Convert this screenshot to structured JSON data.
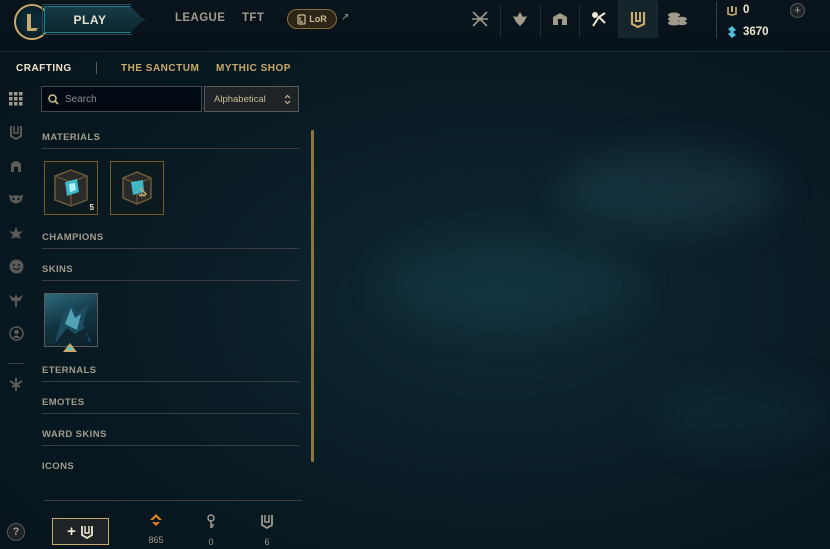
{
  "topbar": {
    "play_label": "PLAY",
    "nav": [
      {
        "label": "LEAGUE",
        "icon": "league-nav"
      },
      {
        "label": "TFT",
        "icon": "tft-nav"
      }
    ],
    "lor_label": "LoR",
    "icons": [
      "rewards-icon",
      "ranked-icon",
      "store-icon",
      "collection-icon",
      "loot-icon",
      "store-currency-icon"
    ],
    "orange_essence": "0",
    "blue_essence": "3670"
  },
  "subnav": {
    "crafting": "CRAFTING",
    "sanctum": "THE SANCTUM",
    "mythic_shop": "MYTHIC SHOP"
  },
  "filters": {
    "search_placeholder": "Search",
    "sort_value": "Alphabetical"
  },
  "sections": {
    "materials": "MATERIALS",
    "champions": "CHAMPIONS",
    "skins": "SKINS",
    "eternals": "ETERNALS",
    "emotes": "EMOTES",
    "ward_skins": "WARD SKINS",
    "icons": "ICONS"
  },
  "materials": [
    {
      "name": "hextech-chest",
      "count": "5"
    },
    {
      "name": "hextech-chest-key",
      "count": ""
    }
  ],
  "footer": {
    "add_symbol": "+",
    "orange_essence_count": "865",
    "keys_count": "0",
    "chests_count": "6",
    "help_label": "?"
  },
  "colors": {
    "gold": "#c8aa6e",
    "hextech_blue": "#0ac8b9",
    "background": "#0a1c25"
  }
}
